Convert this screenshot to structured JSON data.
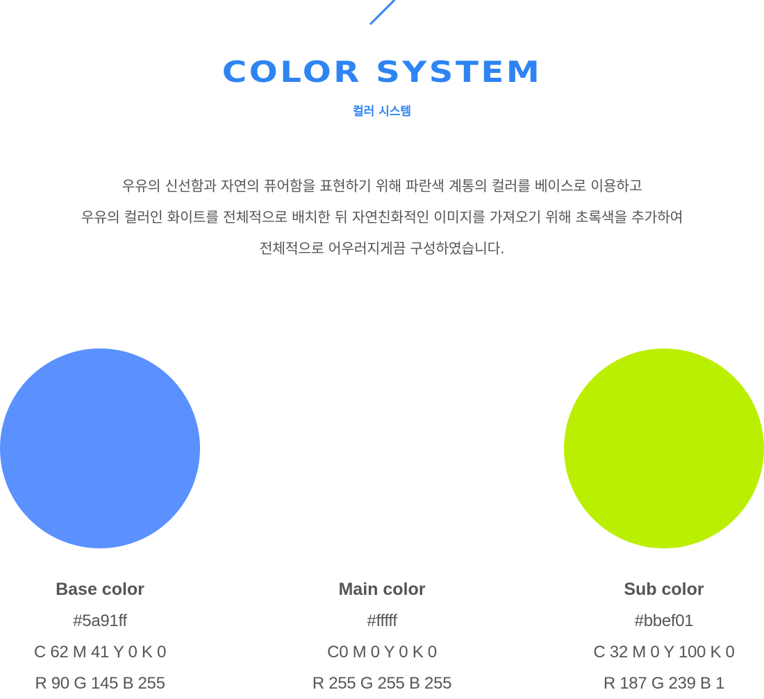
{
  "colors": {
    "accent": "#2e84f2",
    "text": "#555555",
    "background": "#ffffff"
  },
  "header": {
    "decoration_icon": "slash-line-icon",
    "title": "COLOR SYSTEM",
    "subtitle": "컬러 시스템"
  },
  "description": {
    "lines": [
      "우유의 신선함과 자연의 퓨어함을 표현하기 위해 파란색 계통의 컬러를 베이스로 이용하고",
      "우유의 컬러인 화이트를 전체적으로 배치한 뒤 자연친화적인 이미지를 가져오기 위해 초록색을 추가하여",
      "전체적으로 어우러지게끔 구성하였습니다."
    ]
  },
  "swatches": [
    {
      "name": "Base color",
      "hex": "#5a91ff",
      "cmyk": "C 62 M 41 Y 0 K 0",
      "rgb": "R 90 G 145 B 255",
      "fill": "#5a91ff"
    },
    {
      "name": "Main color",
      "hex": "#fffff",
      "cmyk": "C0 M 0 Y 0 K 0",
      "rgb": "R 255 G 255 B 255",
      "fill": "#ffffff"
    },
    {
      "name": "Sub color",
      "hex": "#bbef01",
      "cmyk": "C 32 M 0 Y 100 K 0",
      "rgb": "R 187 G 239 B 1",
      "fill": "#bbef01"
    }
  ]
}
